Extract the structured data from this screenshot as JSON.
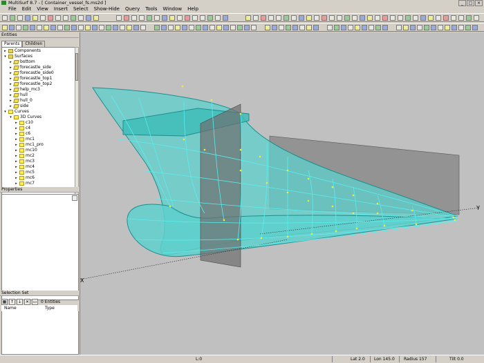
{
  "window": {
    "title": "MultiSurf 8.7 - [ Container_vessel_fs.ms2d ]"
  },
  "menu": [
    "File",
    "Edit",
    "View",
    "Insert",
    "Select",
    "Show-Hide",
    "Query",
    "Tools",
    "Window",
    "Help"
  ],
  "left_panel": {
    "entities_header": "Entities",
    "tabs": [
      "Parents",
      "Children"
    ],
    "tree": [
      {
        "label": "Components",
        "indent": 0,
        "icon": "folder",
        "exp": "+"
      },
      {
        "label": "Surfaces",
        "indent": 0,
        "icon": "folder",
        "exp": "-"
      },
      {
        "label": "bottom",
        "indent": 1,
        "icon": "surf",
        "exp": "+"
      },
      {
        "label": "forecastle_side",
        "indent": 1,
        "icon": "surf",
        "exp": "+"
      },
      {
        "label": "forecastle_side0",
        "indent": 1,
        "icon": "surf",
        "exp": "+"
      },
      {
        "label": "forecastle_top1",
        "indent": 1,
        "icon": "surf",
        "exp": "+"
      },
      {
        "label": "forecastle_top2",
        "indent": 1,
        "icon": "surf",
        "exp": "+"
      },
      {
        "label": "help_mc3",
        "indent": 1,
        "icon": "surf",
        "exp": "+"
      },
      {
        "label": "hull",
        "indent": 1,
        "icon": "surf",
        "exp": "+"
      },
      {
        "label": "hull_0",
        "indent": 1,
        "icon": "surf",
        "exp": "+"
      },
      {
        "label": "side",
        "indent": 1,
        "icon": "surf",
        "exp": "+"
      },
      {
        "label": "Curves",
        "indent": 0,
        "icon": "curve",
        "exp": "-"
      },
      {
        "label": "3D Curves",
        "indent": 1,
        "icon": "curve",
        "exp": "-"
      },
      {
        "label": "c10",
        "indent": 2,
        "icon": "curve",
        "exp": "+"
      },
      {
        "label": "c4",
        "indent": 2,
        "icon": "curve",
        "exp": "+"
      },
      {
        "label": "c6",
        "indent": 2,
        "icon": "curve",
        "exp": "+"
      },
      {
        "label": "mc1",
        "indent": 2,
        "icon": "curve",
        "exp": "+"
      },
      {
        "label": "mc1_pro",
        "indent": 2,
        "icon": "curve",
        "exp": "+"
      },
      {
        "label": "mc10",
        "indent": 2,
        "icon": "curve",
        "exp": "+"
      },
      {
        "label": "mc2",
        "indent": 2,
        "icon": "curve",
        "exp": "+"
      },
      {
        "label": "mc3",
        "indent": 2,
        "icon": "curve",
        "exp": "+"
      },
      {
        "label": "mc4",
        "indent": 2,
        "icon": "curve",
        "exp": "+"
      },
      {
        "label": "mc5",
        "indent": 2,
        "icon": "curve",
        "exp": "+"
      },
      {
        "label": "mc6",
        "indent": 2,
        "icon": "curve",
        "exp": "+"
      },
      {
        "label": "mc7",
        "indent": 2,
        "icon": "curve",
        "exp": "+"
      }
    ],
    "properties_header": "Properties",
    "selection_set_header": "Selection Set",
    "selection_count": "0 Entities",
    "sel_columns": [
      "Name",
      "Type"
    ]
  },
  "viewport": {
    "axis_x": "X",
    "axis_y": "Y",
    "surface_color": "#5ed0cc",
    "edge_color": "#1a8e8e",
    "curve_color": "#56f0f0",
    "point_color": "#f2ef3a",
    "plane_color": "#6e6e6e",
    "background": "#c0c0c0"
  },
  "status": {
    "layer": "L:0",
    "lat": "Lat 2.0",
    "lon": "Lon 145.0",
    "radius": "Radius 157",
    "tilt": "Tilt 0.0"
  }
}
